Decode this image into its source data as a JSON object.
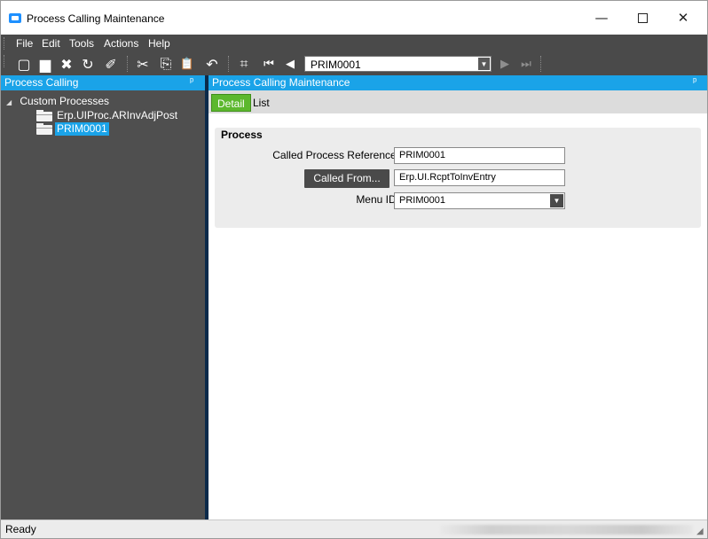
{
  "window": {
    "title": "Process Calling Maintenance",
    "controls": {
      "minimize": "—",
      "close": "✕"
    }
  },
  "menu": {
    "items": [
      "File",
      "Edit",
      "Tools",
      "Actions",
      "Help"
    ]
  },
  "toolbar": {
    "icons": {
      "new": "new-icon",
      "save": "save-icon",
      "delete": "delete-icon",
      "refresh": "refresh-icon",
      "clear": "clear-icon",
      "cut": "cut-icon",
      "copy": "copy-icon",
      "paste": "paste-icon",
      "undo": "undo-icon",
      "search": "binoculars-icon",
      "first": "first-record-icon",
      "previous": "previous-record-icon",
      "next": "next-record-icon",
      "last": "last-record-icon"
    },
    "glyphs": {
      "new": "▢",
      "save": "▆",
      "delete": "✖",
      "refresh": "↻",
      "clear": "✐",
      "cut": "✂",
      "copy": "⎘",
      "paste": "📋",
      "undo": "↶",
      "search": "⌗",
      "first": "⏮",
      "previous": "◀",
      "next": "▶",
      "last": "⏭"
    },
    "record_selector_value": "PRIM0001"
  },
  "left_panel": {
    "title": "Process Calling",
    "pin": "ᵖ",
    "tree": {
      "root_label": "Custom Processes",
      "expander": "◢",
      "items": [
        {
          "label": "Erp.UIProc.ARInvAdjPost",
          "selected": false
        },
        {
          "label": "PRIM0001",
          "selected": true
        }
      ]
    }
  },
  "right_panel": {
    "title": "Process Calling Maintenance",
    "pin": "ᵖ",
    "tabs": [
      {
        "label": "Detail",
        "active": true
      },
      {
        "label": "List",
        "active": false
      }
    ],
    "group": {
      "title": "Process",
      "called_process_reference_label": "Called Process Reference:",
      "called_process_reference_value": "PRIM0001",
      "called_from_button": "Called From...",
      "called_from_value": "Erp.UI.RcptToInvEntry",
      "menu_id_label": "Menu ID:",
      "menu_id_value": "PRIM0001"
    }
  },
  "statusbar": {
    "text": "Ready"
  },
  "colors": {
    "accent": "#1aa3e8",
    "active_tab": "#5cb82e",
    "dark_chrome": "#4a4a4a",
    "panel_bg": "#4f4f4f"
  }
}
